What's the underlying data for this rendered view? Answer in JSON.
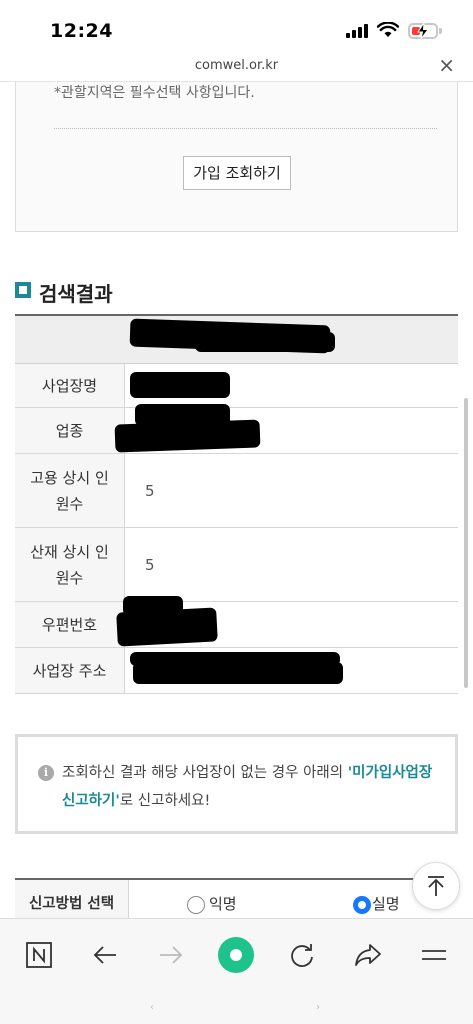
{
  "status_bar": {
    "time": "12:24"
  },
  "browser": {
    "url": "comwel.or.kr",
    "close_label": "×"
  },
  "filter": {
    "required_note": "*관할지역은 필수선택 사항입니다.",
    "lookup_button": "가입 조회하기"
  },
  "results": {
    "section_title": "검색결과",
    "rows": [
      {
        "label": "사업장명",
        "value": ""
      },
      {
        "label": "업종",
        "value": ""
      },
      {
        "label": "고용 상시 인원수",
        "value": "5"
      },
      {
        "label": "산재 상시 인원수",
        "value": "5"
      },
      {
        "label": "우편번호",
        "value": ""
      },
      {
        "label": "사업장 주소",
        "value": ""
      }
    ]
  },
  "notice": {
    "text_before": "조회하신 결과 해당 사업장이 없는 경우 아래의 ",
    "link_text": "'미가입사업장 신고하기'",
    "text_after": "로 신고하세요!"
  },
  "report": {
    "label": "신고방법 선택",
    "options": [
      {
        "label": "익명",
        "selected": false
      },
      {
        "label": "실명",
        "selected": true
      }
    ]
  },
  "bottom_nav": {
    "items": [
      "n-tab-icon",
      "back-arrow-icon",
      "forward-arrow-icon",
      "home-circle-icon",
      "refresh-icon",
      "share-icon",
      "menu-icon"
    ]
  },
  "colors": {
    "accent": "#1a8a96",
    "radio_selected": "#1677ff",
    "home_button": "#1ec28b"
  }
}
